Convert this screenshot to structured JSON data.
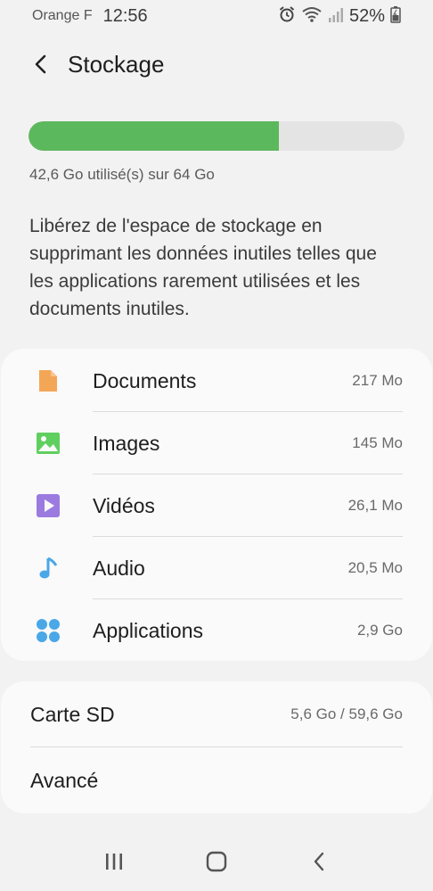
{
  "status_bar": {
    "carrier": "Orange F",
    "time": "12:56",
    "battery": "52%",
    "icons": [
      "alarm-icon",
      "wifi-icon",
      "signal-icon",
      "battery-icon"
    ]
  },
  "header": {
    "title": "Stockage"
  },
  "storage": {
    "used_fraction": 0.666,
    "summary": "42,6 Go utilisé(s) sur 64 Go",
    "bar_color": "#5cb85c"
  },
  "info": {
    "text": "Libérez de l'espace de stockage en supprimant les données inutiles telles que les applications rarement utilisées et les documents inutiles."
  },
  "categories": [
    {
      "label": "Documents",
      "value": "217 Mo",
      "icon": "document-icon",
      "color": "#f4a657"
    },
    {
      "label": "Images",
      "value": "145 Mo",
      "icon": "image-icon",
      "color": "#5fcf5f"
    },
    {
      "label": "Vidéos",
      "value": "26,1 Mo",
      "icon": "video-icon",
      "color": "#9b7be0"
    },
    {
      "label": "Audio",
      "value": "20,5 Mo",
      "icon": "music-note-icon",
      "color": "#4aa7e8"
    },
    {
      "label": "Applications",
      "value": "2,9 Go",
      "icon": "apps-icon",
      "color": "#4aa7e8"
    }
  ],
  "extras": [
    {
      "label": "Carte SD",
      "value": "5,6 Go / 59,6 Go"
    },
    {
      "label": "Avancé",
      "value": ""
    }
  ],
  "navbar": {
    "icons": [
      "recent-apps-icon",
      "home-icon",
      "back-icon"
    ]
  }
}
